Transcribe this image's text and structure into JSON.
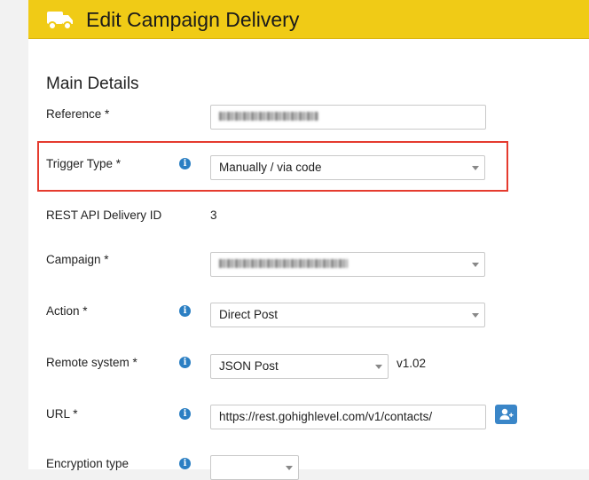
{
  "header": {
    "title": "Edit Campaign Delivery",
    "icon": "truck-icon",
    "background": "#f0cb16"
  },
  "main": {
    "section_title": "Main Details",
    "fields": {
      "reference": {
        "label": "Reference *"
      },
      "trigger_type": {
        "label": "Trigger Type *",
        "value": "Manually / via code"
      },
      "rest_api_id": {
        "label": "REST API Delivery ID",
        "value": "3"
      },
      "campaign": {
        "label": "Campaign *"
      },
      "action": {
        "label": "Action *",
        "value": "Direct Post"
      },
      "remote_system": {
        "label": "Remote system *",
        "value": "JSON Post",
        "version": "v1.02"
      },
      "url": {
        "label": "URL *",
        "value": "https://rest.gohighlevel.com/v1/contacts/"
      },
      "encryption_type": {
        "label": "Encryption type",
        "value": ""
      }
    },
    "highlight_color": "#e53b2e"
  }
}
